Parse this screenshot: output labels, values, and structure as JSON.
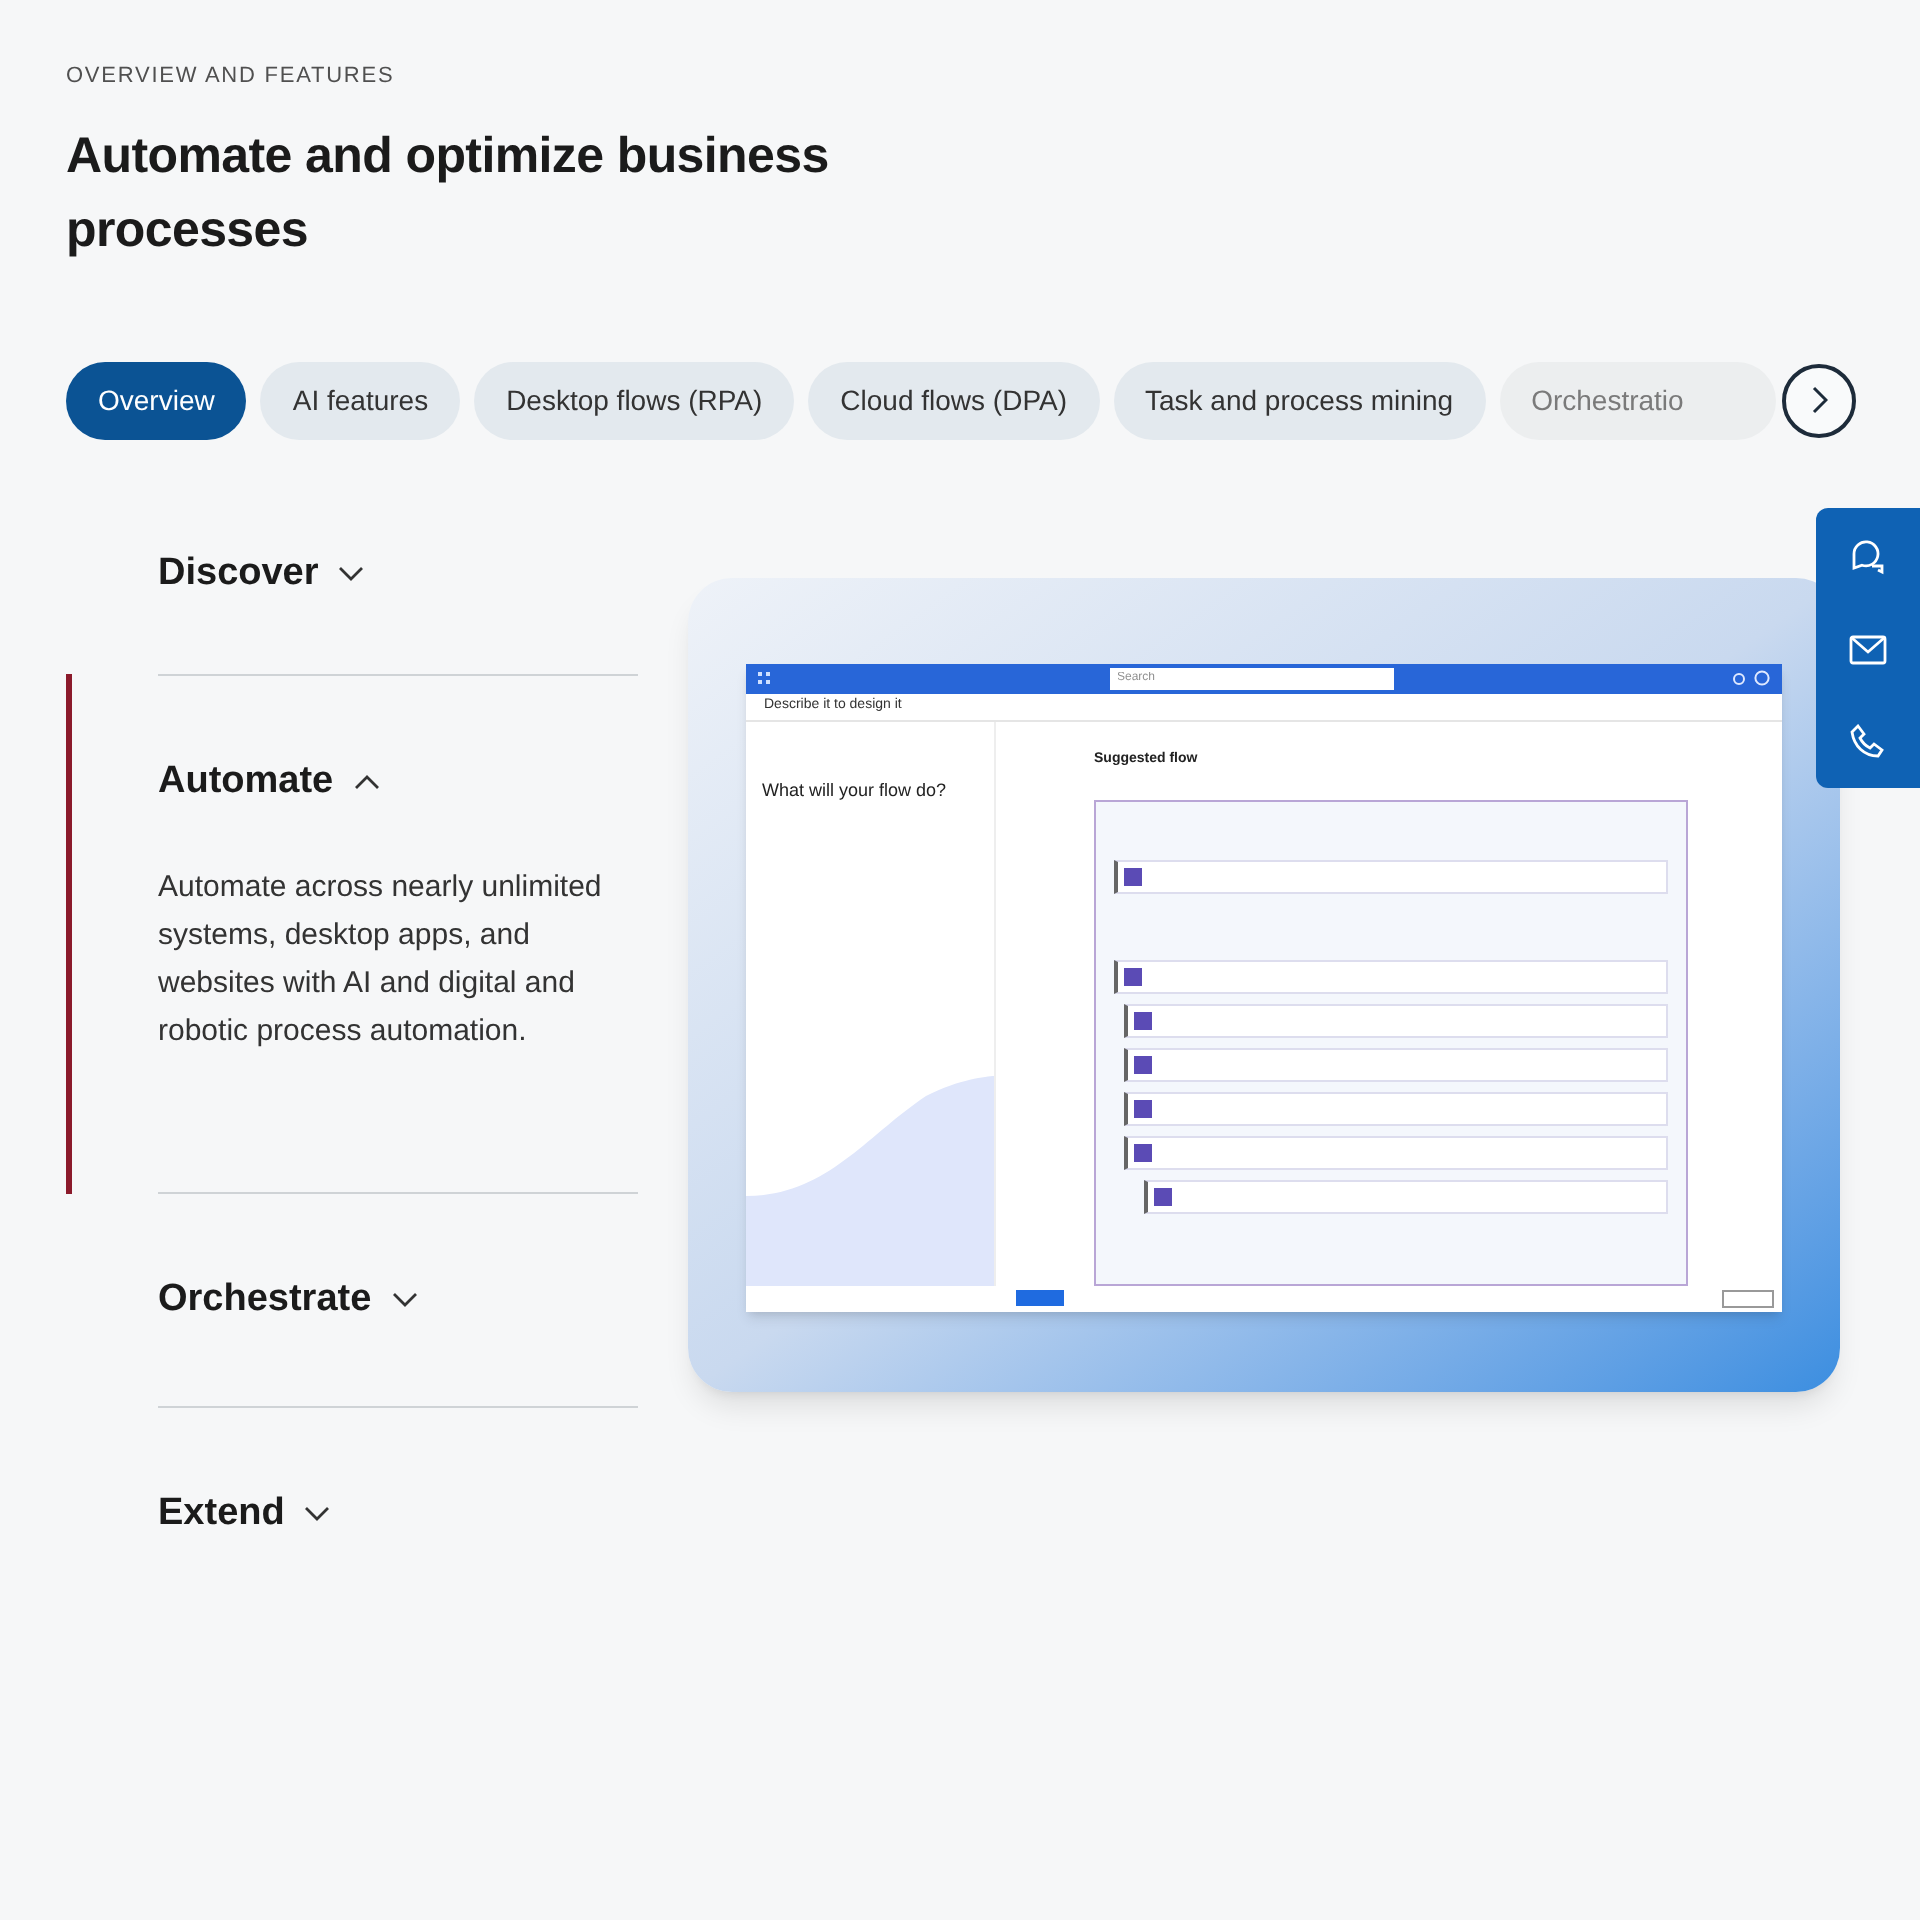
{
  "eyebrow": "OVERVIEW AND FEATURES",
  "title": "Automate and optimize business processes",
  "tabs": [
    {
      "label": "Overview",
      "selected": true
    },
    {
      "label": "AI features",
      "selected": false
    },
    {
      "label": "Desktop flows (RPA)",
      "selected": false
    },
    {
      "label": "Cloud flows (DPA)",
      "selected": false
    },
    {
      "label": "Task and process mining",
      "selected": false
    },
    {
      "label": "Orchestratio",
      "selected": false
    }
  ],
  "accordion": [
    {
      "title": "Discover",
      "expanded": false
    },
    {
      "title": "Automate",
      "expanded": true,
      "body": "Automate across nearly unlimited systems, desktop apps, and websites with AI and digital and robotic process automation."
    },
    {
      "title": "Orchestrate",
      "expanded": false
    },
    {
      "title": "Extend",
      "expanded": false
    }
  ],
  "preview": {
    "search": {
      "placeholder": "Search"
    },
    "page_title": "Describe it to design it",
    "step_heading": "What will your flow do?",
    "panel_title": "Suggested flow"
  }
}
